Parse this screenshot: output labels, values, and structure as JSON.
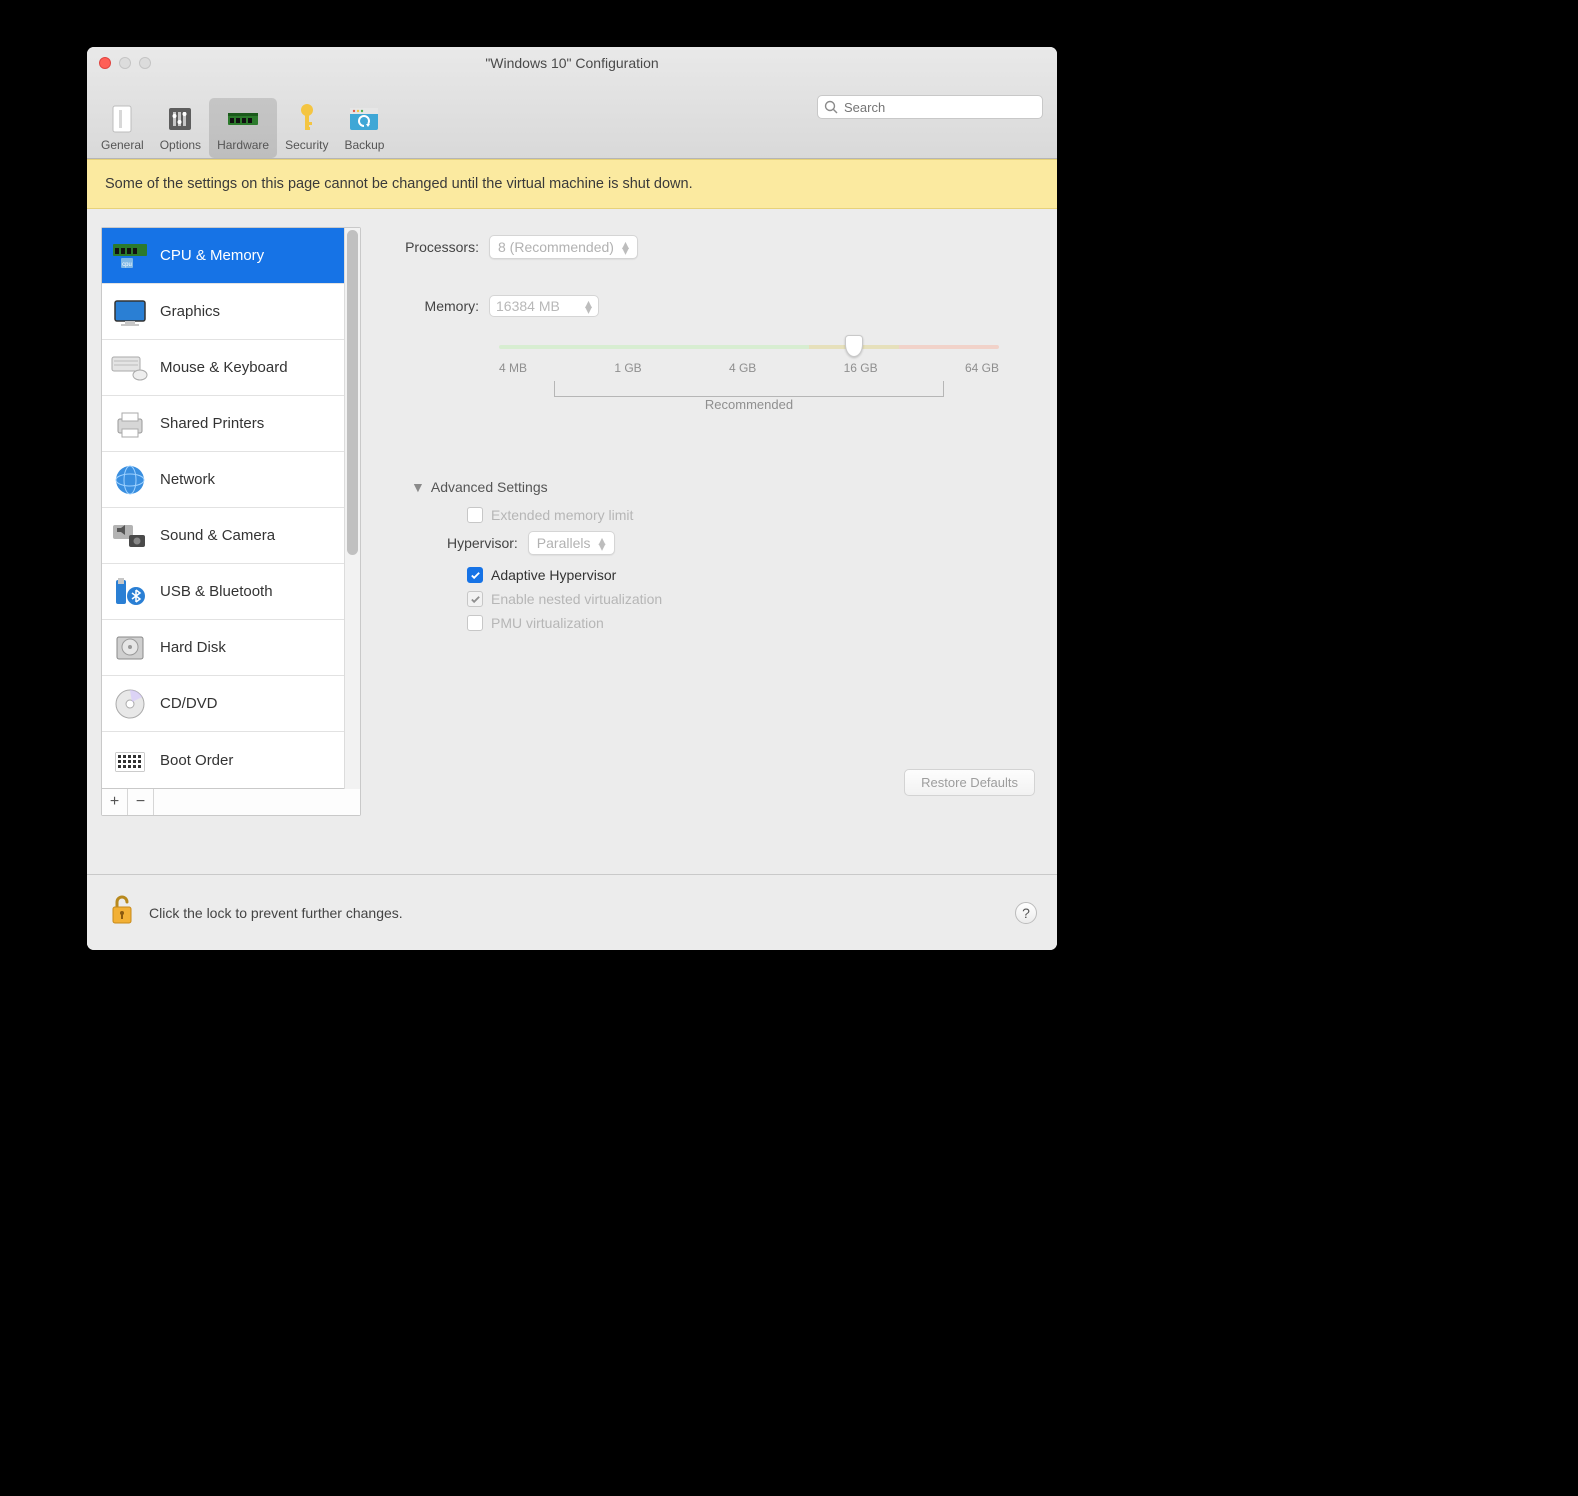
{
  "window": {
    "title": "\"Windows 10\" Configuration"
  },
  "toolbar": {
    "items": [
      {
        "label": "General"
      },
      {
        "label": "Options"
      },
      {
        "label": "Hardware"
      },
      {
        "label": "Security"
      },
      {
        "label": "Backup"
      }
    ],
    "selected_index": 2
  },
  "search": {
    "placeholder": "Search"
  },
  "warning": {
    "text": "Some of the settings on this page cannot be changed until the virtual machine is shut down."
  },
  "sidebar": {
    "items": [
      {
        "label": "CPU & Memory"
      },
      {
        "label": "Graphics"
      },
      {
        "label": "Mouse & Keyboard"
      },
      {
        "label": "Shared Printers"
      },
      {
        "label": "Network"
      },
      {
        "label": "Sound & Camera"
      },
      {
        "label": "USB & Bluetooth"
      },
      {
        "label": "Hard Disk"
      },
      {
        "label": "CD/DVD"
      },
      {
        "label": "Boot Order"
      }
    ],
    "selected_index": 0
  },
  "cpu_memory": {
    "processors_label": "Processors:",
    "processors_value": "8 (Recommended)",
    "memory_label": "Memory:",
    "memory_value": "16384 MB",
    "slider_ticks": [
      "4 MB",
      "1 GB",
      "4 GB",
      "16 GB",
      "64 GB"
    ],
    "recommended_label": "Recommended",
    "advanced_header": "Advanced Settings",
    "extended_memory_label": "Extended memory limit",
    "extended_memory_checked": false,
    "hypervisor_label": "Hypervisor:",
    "hypervisor_value": "Parallels",
    "adaptive_label": "Adaptive Hypervisor",
    "adaptive_checked": true,
    "nested_label": "Enable nested virtualization",
    "nested_checked": true,
    "pmu_label": "PMU virtualization",
    "pmu_checked": false,
    "restore_label": "Restore Defaults"
  },
  "footer": {
    "lock_text": "Click the lock to prevent further changes.",
    "help": "?"
  }
}
